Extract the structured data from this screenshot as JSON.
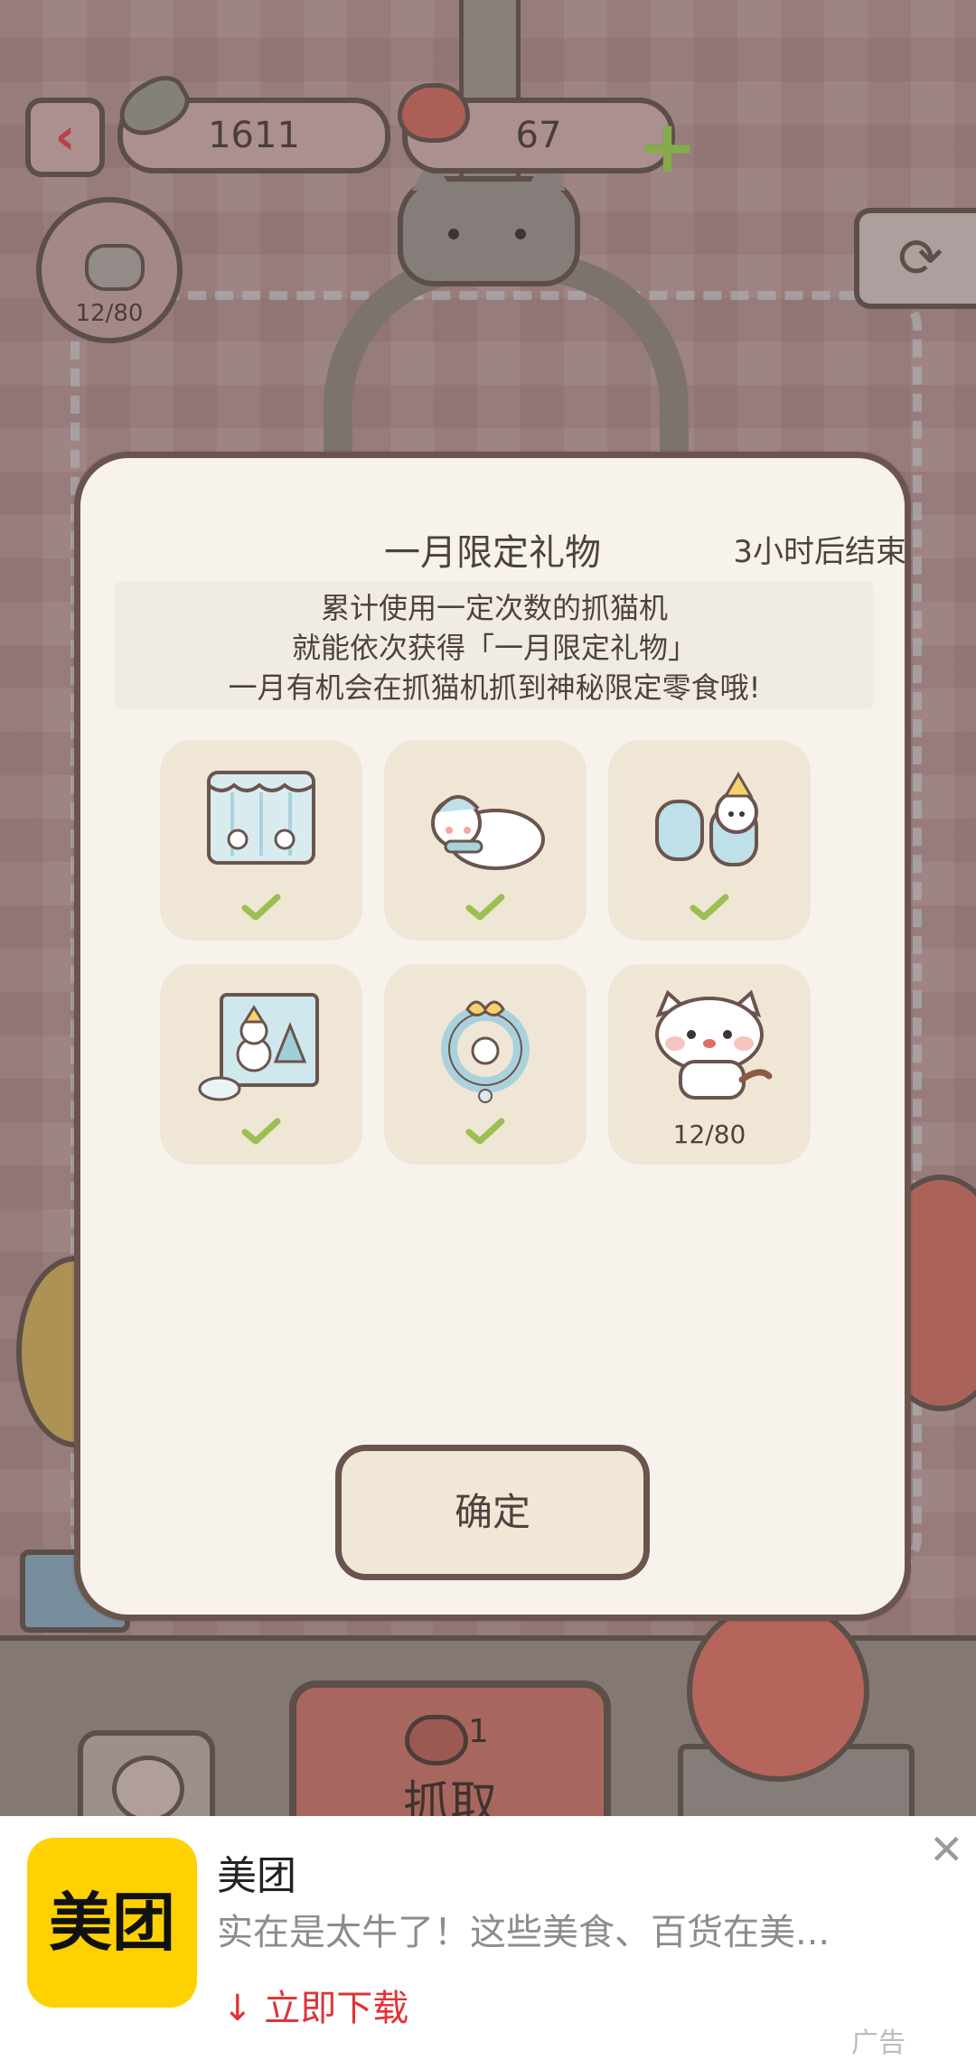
{
  "hud": {
    "fish_count": "1611",
    "heart_count": "67",
    "collection_progress": "12/80"
  },
  "controls": {
    "grab_cost": "1",
    "grab_label": "抓取"
  },
  "dialog": {
    "title": "一月限定礼物",
    "timer": "3小时后结束",
    "description": [
      "累计使用一定次数的抓猫机",
      "就能依次获得「一月限定礼物」",
      "一月有机会在抓猫机抓到神秘限定零食哦!"
    ],
    "gifts": [
      {
        "icon": "curtain-icon",
        "claimed": true
      },
      {
        "icon": "sleeping-snowman-icon",
        "claimed": true
      },
      {
        "icon": "mittens-icon",
        "claimed": true
      },
      {
        "icon": "snow-painting-icon",
        "claimed": true
      },
      {
        "icon": "wreath-icon",
        "claimed": true
      },
      {
        "icon": "white-cat-icon",
        "claimed": false,
        "progress": "12/80"
      }
    ],
    "confirm_label": "确定"
  },
  "ad": {
    "logo_text": "美团",
    "title": "美团",
    "description": "实在是太牛了！这些美食、百货在美...",
    "cta": "↓ 立即下载",
    "tag": "广告",
    "close_icon": "close-icon"
  },
  "colors": {
    "brand_yellow": "#ffd100",
    "cta_red": "#e0333a",
    "check_green": "#9bc04f"
  }
}
